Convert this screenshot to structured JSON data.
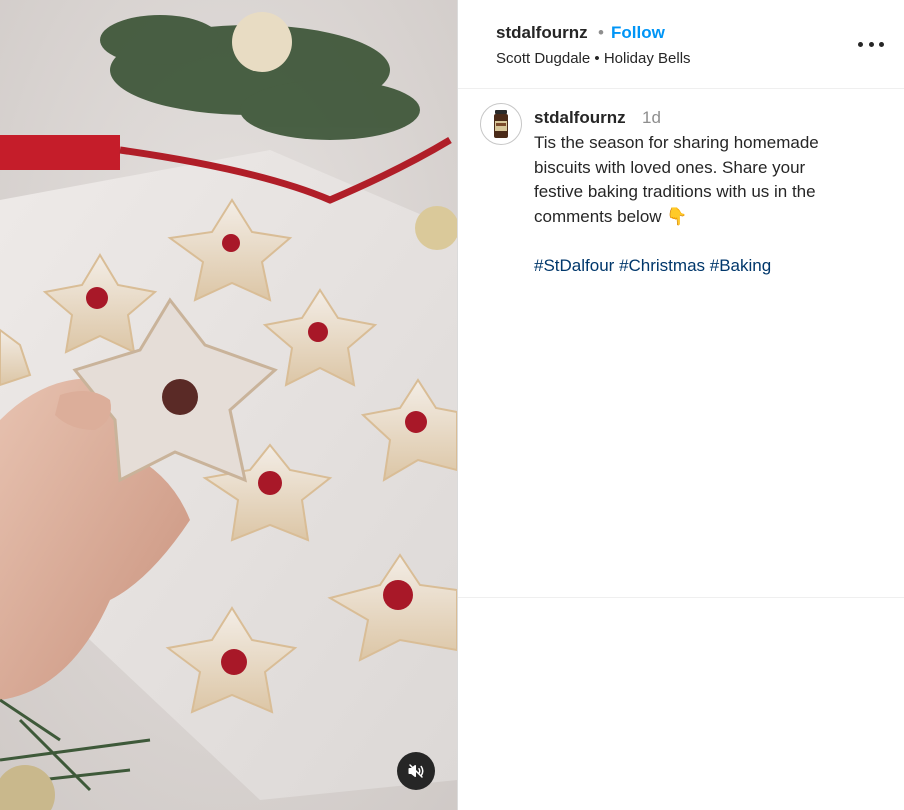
{
  "post": {
    "media": {
      "alt": "",
      "mute_icon": "speaker-muted-icon"
    },
    "header": {
      "username": "stdalfournz",
      "separator": "•",
      "follow_label": "Follow",
      "audio_artist": "Scott Dugdale",
      "audio_separator": "•",
      "audio_title": "Holiday Bells",
      "more_icon": "more-options-icon"
    },
    "caption": {
      "username": "stdalfournz",
      "time": "1d",
      "lines": [
        "Tis the season for sharing homemade",
        "biscuits with loved ones. Share your",
        "festive baking traditions with us in the",
        "comments below 👇"
      ],
      "hashtags": [
        "#StDalfour",
        "#Christmas",
        "#Baking"
      ]
    }
  }
}
